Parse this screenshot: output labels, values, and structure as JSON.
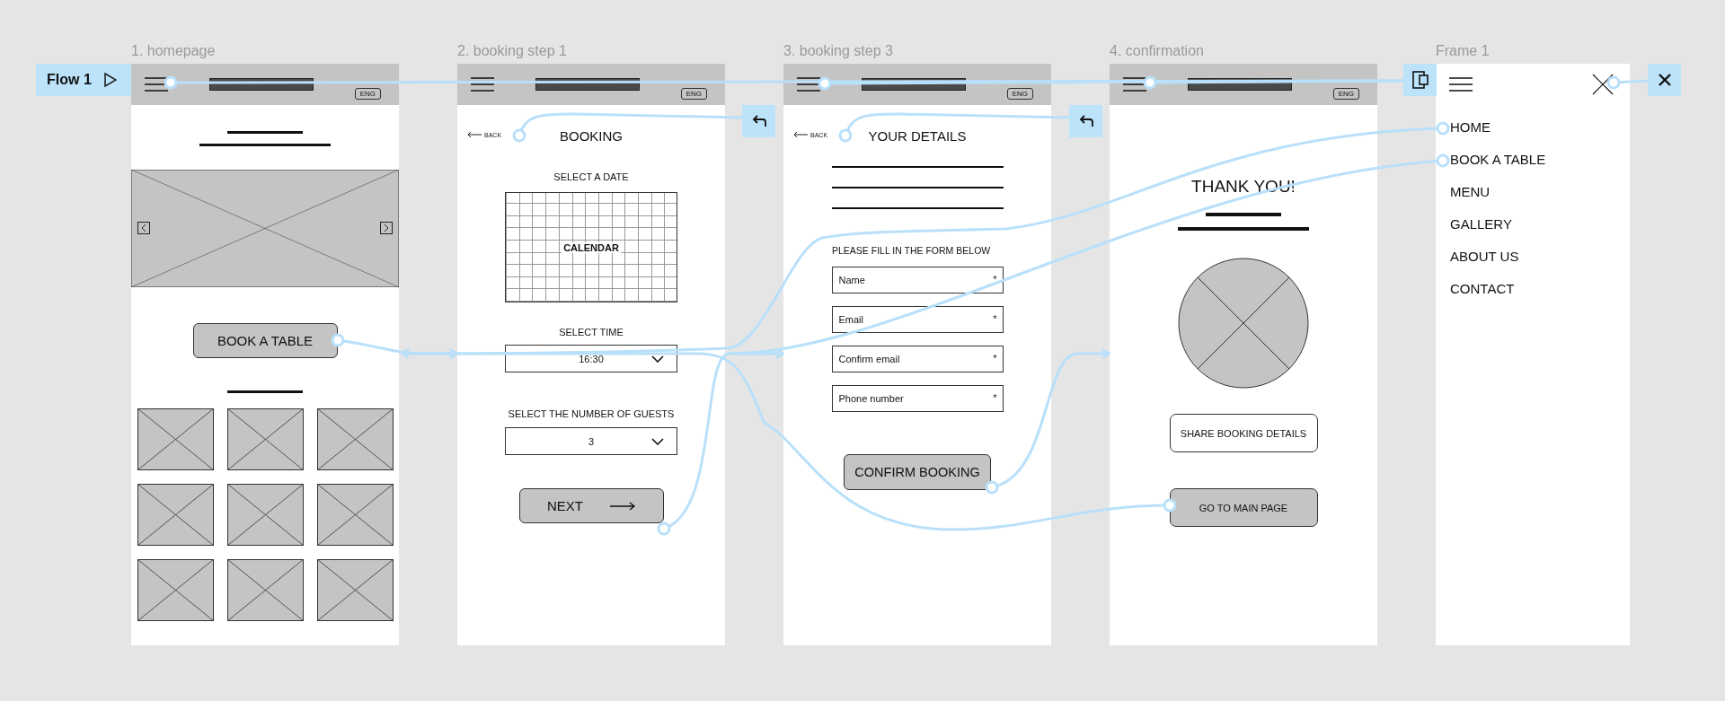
{
  "flow": {
    "label": "Flow 1"
  },
  "frames": [
    {
      "kind": "homepage",
      "title": "1. homepage",
      "language": "ENG",
      "button": "BOOK A TABLE"
    },
    {
      "kind": "booking_date",
      "title": "2. booking step 1",
      "language": "ENG",
      "back": "BACK",
      "heading": "BOOKING",
      "date_label": "SELECT A DATE",
      "calendar": "CALENDAR",
      "time_label": "SELECT TIME",
      "time": "16:30",
      "guests_label": "SELECT THE NUMBER OF GUESTS",
      "guests": "3",
      "button": "NEXT"
    },
    {
      "kind": "details",
      "title": "3. booking step 3",
      "language": "ENG",
      "back": "BACK",
      "heading": "YOUR DETAILS",
      "instruction": "PLEASE FILL IN THE FORM BELOW",
      "fields": [
        {
          "placeholder": "Name",
          "marker": "*"
        },
        {
          "placeholder": "Email",
          "marker": "*"
        },
        {
          "placeholder": "Confirm email",
          "marker": "*"
        },
        {
          "placeholder": "Phone number",
          "marker": "*"
        }
      ],
      "button": "CONFIRM BOOKING"
    },
    {
      "kind": "confirmation",
      "title": "4. confirmation",
      "language": "ENG",
      "heading": "THANK YOU!",
      "buttons": [
        {
          "label": "SHARE BOOKING DETAILS",
          "filled": false
        },
        {
          "label": "GO TO MAIN PAGE",
          "filled": true
        }
      ]
    },
    {
      "kind": "menu",
      "title": "Frame 1",
      "items": [
        "HOME",
        "BOOK A TABLE",
        "MENU",
        "GALLERY",
        "ABOUT US",
        "CONTACT"
      ]
    }
  ]
}
